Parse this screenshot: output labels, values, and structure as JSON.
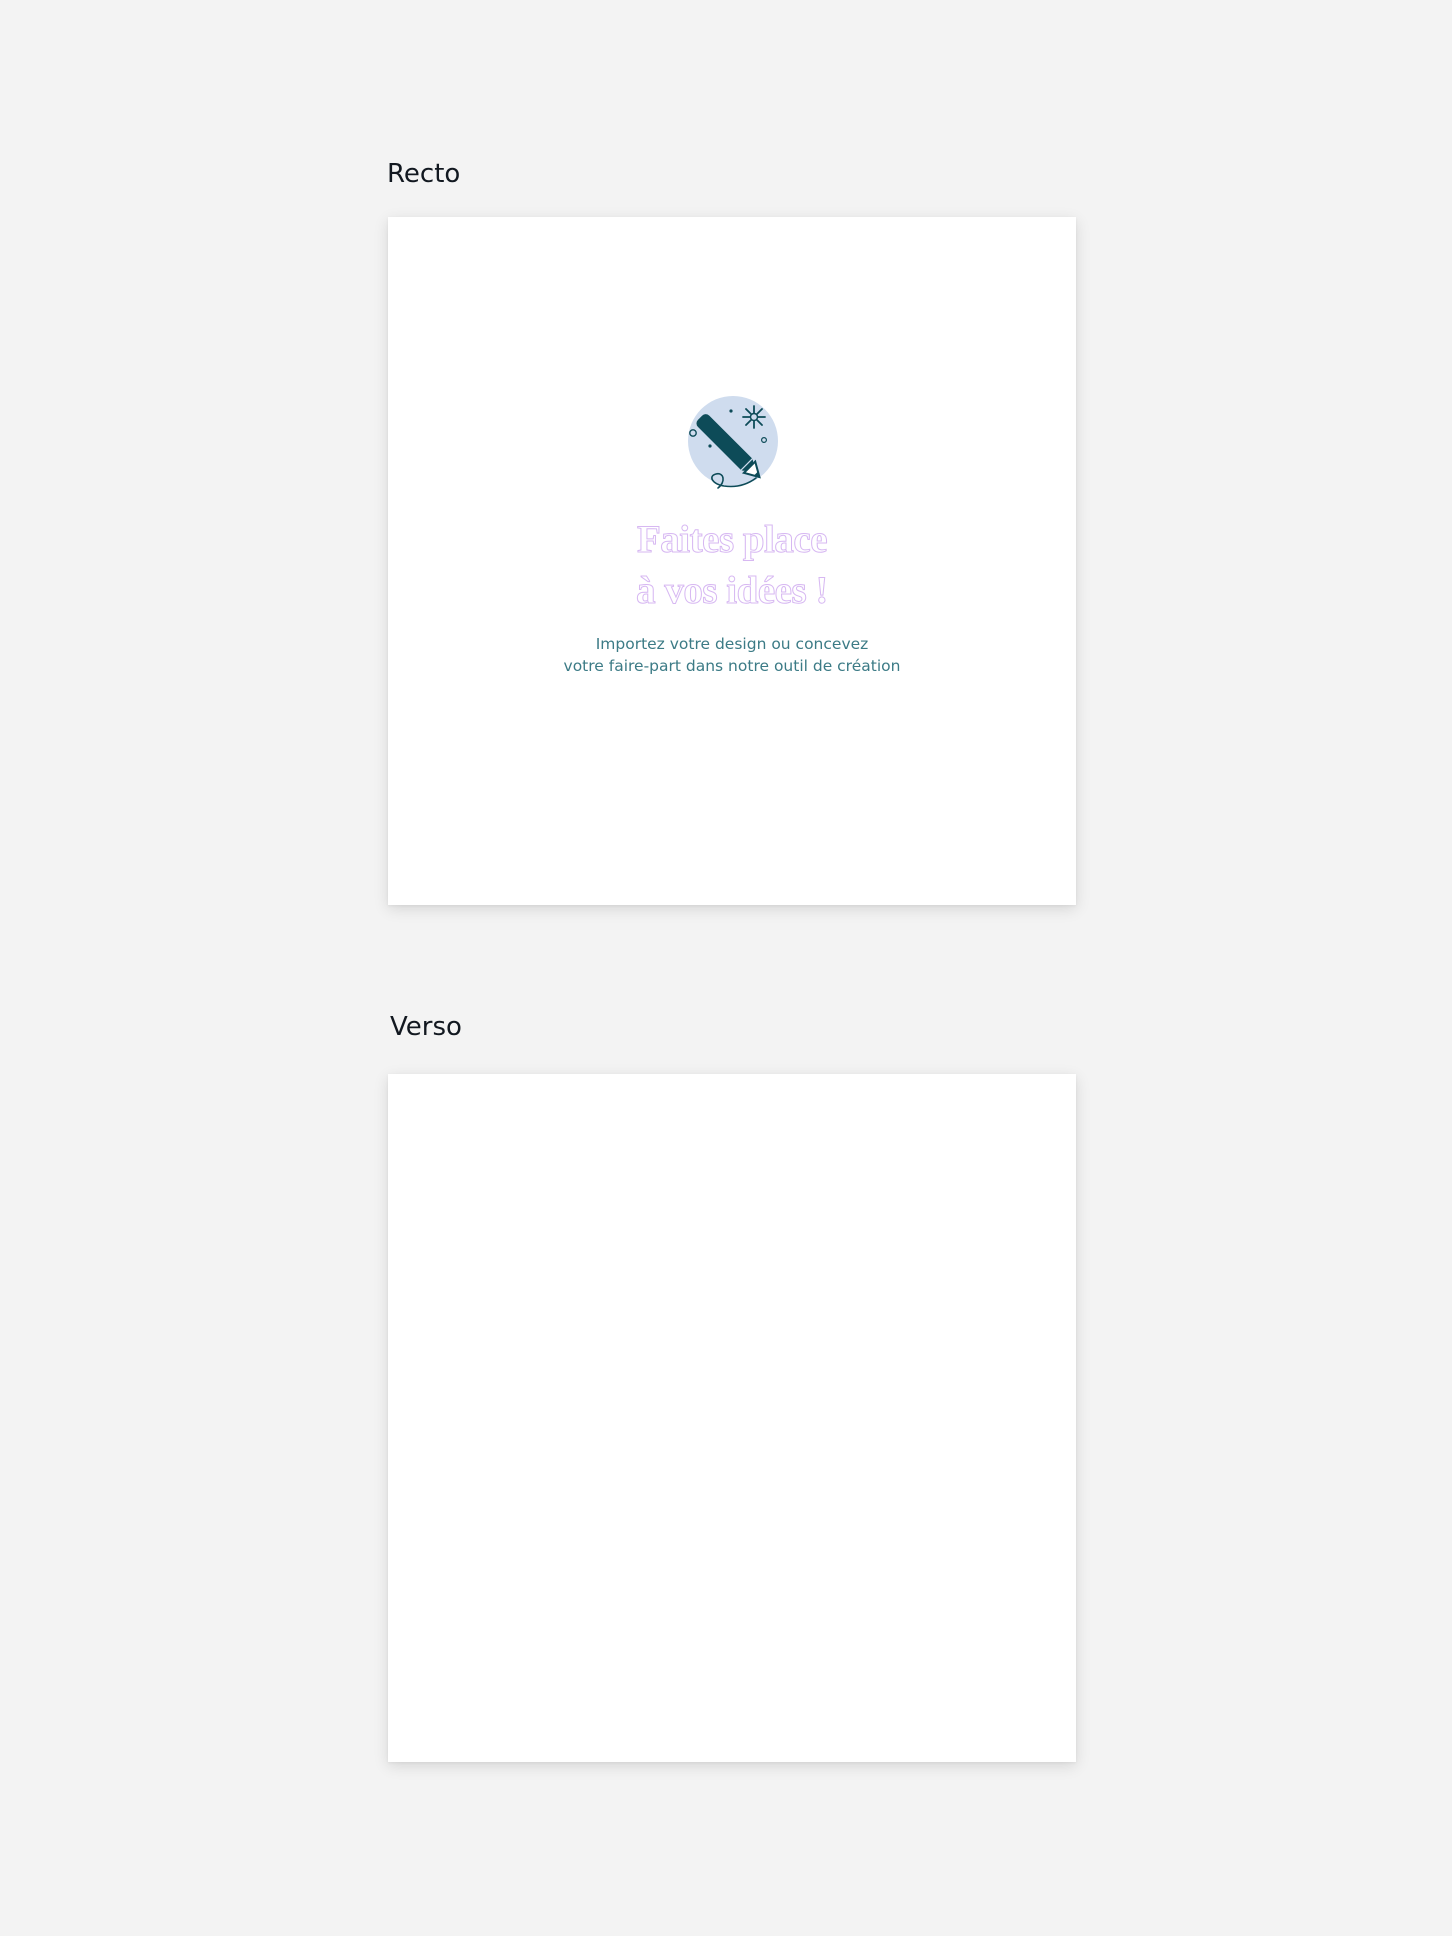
{
  "recto": {
    "label": "Recto",
    "empty_state": {
      "illustration_icon": "pencil-icon",
      "headline_line1": "Faites place",
      "headline_line2": "à vos idées !",
      "subtext_line1": "Importez votre design ou concevez",
      "subtext_line2": "votre faire-part dans notre outil de création"
    }
  },
  "verso": {
    "label": "Verso"
  },
  "colors": {
    "page_background": "#f3f3f3",
    "card_background": "#ffffff",
    "icon_dark": "#0d4b58",
    "icon_circle": "#cfdcee",
    "headline_outline": "#d7b8f2",
    "subtext": "#3c7b86",
    "label_text": "#121820"
  }
}
